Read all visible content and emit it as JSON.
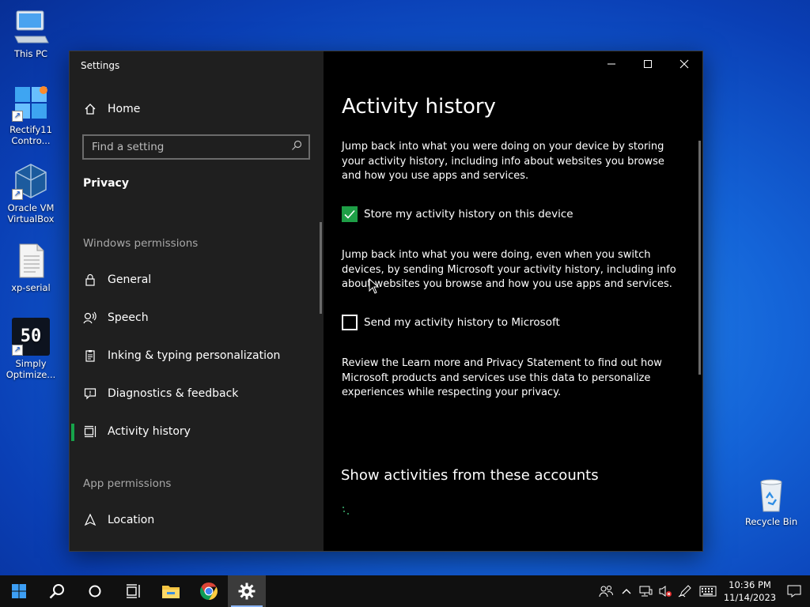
{
  "desktop": {
    "icons": [
      {
        "label": "This PC",
        "icon": "computer-icon"
      },
      {
        "label": "Rectify11 Contro...",
        "icon": "control-panel-icon"
      },
      {
        "label": "Oracle VM VirtualBox",
        "icon": "virtualbox-icon"
      },
      {
        "label": "xp-serial",
        "icon": "text-file-icon"
      },
      {
        "label": "Simply Optimize...",
        "icon": "simply-optimize-icon",
        "glyph_text": "50"
      },
      {
        "label": "Recycle Bin",
        "icon": "recycle-bin-icon"
      }
    ]
  },
  "window": {
    "title": "Settings",
    "sidebar": {
      "home_label": "Home",
      "search_placeholder": "Find a setting",
      "category": "Privacy",
      "sections": {
        "windows_permissions": "Windows permissions",
        "app_permissions": "App permissions"
      },
      "items": [
        {
          "label": "General",
          "icon": "lock-icon"
        },
        {
          "label": "Speech",
          "icon": "speech-icon"
        },
        {
          "label": "Inking & typing personalization",
          "icon": "clipboard-icon"
        },
        {
          "label": "Diagnostics & feedback",
          "icon": "feedback-icon"
        },
        {
          "label": "Activity history",
          "icon": "timeline-icon",
          "active": true
        },
        {
          "label": "Location",
          "icon": "location-icon"
        }
      ]
    },
    "content": {
      "title": "Activity history",
      "intro": "Jump back into what you were doing on your device by storing your activity history, including info about websites you browse and how you use apps and services.",
      "store_checkbox": {
        "label": "Store my activity history on this device",
        "checked": true
      },
      "send_description": "Jump back into what you were doing, even when you switch devices, by sending Microsoft your activity history, including info about websites you browse and how you use apps and services.",
      "send_checkbox": {
        "label": "Send my activity history to Microsoft",
        "checked": false
      },
      "privacy_note": "Review the Learn more and Privacy Statement to find out how Microsoft products and services use this data to personalize experiences while respecting your privacy.",
      "accounts_heading": "Show activities from these accounts"
    }
  },
  "taskbar": {
    "apps": [
      "start-icon",
      "search-icon",
      "cortana-icon",
      "task-view-icon",
      "file-explorer-icon",
      "chrome-icon",
      "settings-icon"
    ],
    "clock": {
      "time": "10:36 PM",
      "date": "11/14/2023"
    }
  },
  "colors": {
    "accent": "#1e9e46",
    "sidebar": "#1f1f1f",
    "content": "#000000",
    "taskbar": "#101010"
  }
}
